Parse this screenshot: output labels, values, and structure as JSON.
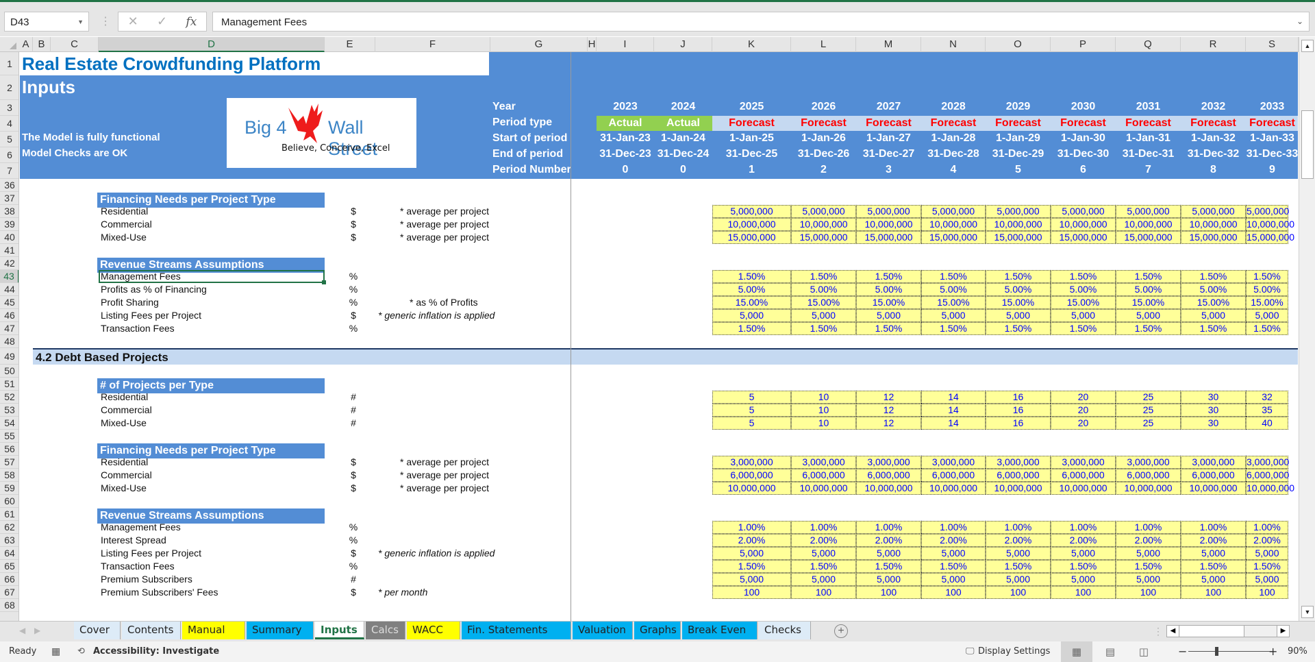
{
  "formula_bar": {
    "name_box": "D43",
    "cancel_icon": "✕",
    "enter_icon": "✓",
    "fx_label": "fx",
    "formula": "Management Fees"
  },
  "columns": [
    "A",
    "B",
    "C",
    "D",
    "E",
    "F",
    "G",
    "H",
    "I",
    "J",
    "K",
    "L",
    "M",
    "N",
    "O",
    "P",
    "Q",
    "R",
    "S"
  ],
  "selected_column": "D",
  "rows": [
    "1",
    "2",
    "3",
    "4",
    "5",
    "6",
    "7",
    "36",
    "37",
    "38",
    "39",
    "40",
    "41",
    "42",
    "43",
    "44",
    "45",
    "46",
    "47",
    "48",
    "49",
    "50",
    "51",
    "52",
    "53",
    "54",
    "55",
    "56",
    "57",
    "58",
    "59",
    "60",
    "61",
    "62",
    "63",
    "64",
    "65",
    "66",
    "67",
    "68"
  ],
  "selected_row": "43",
  "header": {
    "title": "Real Estate Crowdfunding Platform",
    "subtitle": "Inputs",
    "status_line1": "The Model is fully functional",
    "status_line2": "Model Checks are OK",
    "logo": {
      "left_text": "Big 4",
      "right_text": "Wall Street",
      "tagline": "Believe, Conceive, Excel"
    },
    "row_labels": {
      "year": "Year",
      "period_type": "Period type",
      "start": "Start of period",
      "end": "End of period",
      "number": "Period Number"
    },
    "periods": [
      {
        "year": "2023",
        "type": "Actual",
        "start": "31-Jan-23",
        "end": "31-Dec-23",
        "num": "0"
      },
      {
        "year": "2024",
        "type": "Actual",
        "start": "1-Jan-24",
        "end": "31-Dec-24",
        "num": "0"
      },
      {
        "year": "2025",
        "type": "Forecast",
        "start": "1-Jan-25",
        "end": "31-Dec-25",
        "num": "1"
      },
      {
        "year": "2026",
        "type": "Forecast",
        "start": "1-Jan-26",
        "end": "31-Dec-26",
        "num": "2"
      },
      {
        "year": "2027",
        "type": "Forecast",
        "start": "1-Jan-27",
        "end": "31-Dec-27",
        "num": "3"
      },
      {
        "year": "2028",
        "type": "Forecast",
        "start": "1-Jan-28",
        "end": "31-Dec-28",
        "num": "4"
      },
      {
        "year": "2029",
        "type": "Forecast",
        "start": "1-Jan-29",
        "end": "31-Dec-29",
        "num": "5"
      },
      {
        "year": "2030",
        "type": "Forecast",
        "start": "1-Jan-30",
        "end": "31-Dec-30",
        "num": "6"
      },
      {
        "year": "2031",
        "type": "Forecast",
        "start": "1-Jan-31",
        "end": "31-Dec-31",
        "num": "7"
      },
      {
        "year": "2032",
        "type": "Forecast",
        "start": "1-Jan-32",
        "end": "31-Dec-32",
        "num": "8"
      },
      {
        "year": "2033",
        "type": "Forecast",
        "start": "1-Jan-33",
        "end": "31-Dec-33",
        "num": "9"
      }
    ]
  },
  "equity_section": {
    "financing": {
      "title": "Financing Needs per Project Type",
      "rows": [
        {
          "label": "Residential",
          "unit": "$",
          "note": "* average per project",
          "values": [
            "5,000,000",
            "5,000,000",
            "5,000,000",
            "5,000,000",
            "5,000,000",
            "5,000,000",
            "5,000,000",
            "5,000,000",
            "5,000,000"
          ]
        },
        {
          "label": "Commercial",
          "unit": "$",
          "note": "* average per project",
          "values": [
            "10,000,000",
            "10,000,000",
            "10,000,000",
            "10,000,000",
            "10,000,000",
            "10,000,000",
            "10,000,000",
            "10,000,000",
            "10,000,000"
          ]
        },
        {
          "label": "Mixed-Use",
          "unit": "$",
          "note": "* average per project",
          "values": [
            "15,000,000",
            "15,000,000",
            "15,000,000",
            "15,000,000",
            "15,000,000",
            "15,000,000",
            "15,000,000",
            "15,000,000",
            "15,000,000"
          ]
        }
      ]
    },
    "revenue": {
      "title": "Revenue Streams Assumptions",
      "rows": [
        {
          "label": "Management Fees",
          "unit": "%",
          "note": "",
          "values": [
            "1.50%",
            "1.50%",
            "1.50%",
            "1.50%",
            "1.50%",
            "1.50%",
            "1.50%",
            "1.50%",
            "1.50%"
          ]
        },
        {
          "label": "Profits as % of Financing",
          "unit": "%",
          "note": "",
          "values": [
            "5.00%",
            "5.00%",
            "5.00%",
            "5.00%",
            "5.00%",
            "5.00%",
            "5.00%",
            "5.00%",
            "5.00%"
          ]
        },
        {
          "label": "Profit Sharing",
          "unit": "%",
          "note": "* as % of Profits",
          "values": [
            "15.00%",
            "15.00%",
            "15.00%",
            "15.00%",
            "15.00%",
            "15.00%",
            "15.00%",
            "15.00%",
            "15.00%"
          ]
        },
        {
          "label": "Listing Fees per Project",
          "unit": "$",
          "note": "* generic inflation is applied",
          "values": [
            "5,000",
            "5,000",
            "5,000",
            "5,000",
            "5,000",
            "5,000",
            "5,000",
            "5,000",
            "5,000"
          ]
        },
        {
          "label": "Transaction Fees",
          "unit": "%",
          "note": "",
          "values": [
            "1.50%",
            "1.50%",
            "1.50%",
            "1.50%",
            "1.50%",
            "1.50%",
            "1.50%",
            "1.50%",
            "1.50%"
          ]
        }
      ]
    }
  },
  "debt_section": {
    "title": "4.2 Debt Based Projects",
    "projects": {
      "title": "# of Projects per Type",
      "rows": [
        {
          "label": "Residential",
          "unit": "#",
          "note": "",
          "values": [
            "5",
            "10",
            "12",
            "14",
            "16",
            "20",
            "25",
            "30",
            "32"
          ]
        },
        {
          "label": "Commercial",
          "unit": "#",
          "note": "",
          "values": [
            "5",
            "10",
            "12",
            "14",
            "16",
            "20",
            "25",
            "30",
            "35"
          ]
        },
        {
          "label": "Mixed-Use",
          "unit": "#",
          "note": "",
          "values": [
            "5",
            "10",
            "12",
            "14",
            "16",
            "20",
            "25",
            "30",
            "40"
          ]
        }
      ]
    },
    "financing": {
      "title": "Financing Needs per Project Type",
      "rows": [
        {
          "label": "Residential",
          "unit": "$",
          "note": "* average per project",
          "values": [
            "3,000,000",
            "3,000,000",
            "3,000,000",
            "3,000,000",
            "3,000,000",
            "3,000,000",
            "3,000,000",
            "3,000,000",
            "3,000,000"
          ]
        },
        {
          "label": "Commercial",
          "unit": "$",
          "note": "* average per project",
          "values": [
            "6,000,000",
            "6,000,000",
            "6,000,000",
            "6,000,000",
            "6,000,000",
            "6,000,000",
            "6,000,000",
            "6,000,000",
            "6,000,000"
          ]
        },
        {
          "label": "Mixed-Use",
          "unit": "$",
          "note": "* average per project",
          "values": [
            "10,000,000",
            "10,000,000",
            "10,000,000",
            "10,000,000",
            "10,000,000",
            "10,000,000",
            "10,000,000",
            "10,000,000",
            "10,000,000"
          ]
        }
      ]
    },
    "revenue": {
      "title": "Revenue Streams Assumptions",
      "rows": [
        {
          "label": "Management Fees",
          "unit": "%",
          "note": "",
          "values": [
            "1.00%",
            "1.00%",
            "1.00%",
            "1.00%",
            "1.00%",
            "1.00%",
            "1.00%",
            "1.00%",
            "1.00%"
          ]
        },
        {
          "label": "Interest Spread",
          "unit": "%",
          "note": "",
          "values": [
            "2.00%",
            "2.00%",
            "2.00%",
            "2.00%",
            "2.00%",
            "2.00%",
            "2.00%",
            "2.00%",
            "2.00%"
          ]
        },
        {
          "label": "Listing Fees per Project",
          "unit": "$",
          "note": "* generic inflation is applied",
          "values": [
            "5,000",
            "5,000",
            "5,000",
            "5,000",
            "5,000",
            "5,000",
            "5,000",
            "5,000",
            "5,000"
          ]
        },
        {
          "label": "Transaction Fees",
          "unit": "%",
          "note": "",
          "values": [
            "1.50%",
            "1.50%",
            "1.50%",
            "1.50%",
            "1.50%",
            "1.50%",
            "1.50%",
            "1.50%",
            "1.50%"
          ]
        },
        {
          "label": "Premium Subscribers",
          "unit": "#",
          "note": "",
          "values": [
            "5,000",
            "5,000",
            "5,000",
            "5,000",
            "5,000",
            "5,000",
            "5,000",
            "5,000",
            "5,000"
          ]
        },
        {
          "label": "Premium Subscribers' Fees",
          "unit": "$",
          "note": "* per month",
          "values": [
            "100",
            "100",
            "100",
            "100",
            "100",
            "100",
            "100",
            "100",
            "100"
          ]
        }
      ]
    }
  },
  "sheet_tabs": [
    {
      "label": "Cover",
      "color": "#ddebf7"
    },
    {
      "label": "Contents",
      "color": "#ddebf7"
    },
    {
      "label": "Manual",
      "color": "#ffff00"
    },
    {
      "label": "Summary",
      "color": "#00b0f0"
    },
    {
      "label": "Inputs",
      "color": "#ffffff",
      "active": true
    },
    {
      "label": "Calcs",
      "color": "#808080"
    },
    {
      "label": "WACC",
      "color": "#ffff00"
    },
    {
      "label": "Fin. Statements",
      "color": "#00b0f0"
    },
    {
      "label": "Valuation",
      "color": "#00b0f0"
    },
    {
      "label": "Graphs",
      "color": "#00b0f0"
    },
    {
      "label": "Break Even",
      "color": "#00b0f0"
    },
    {
      "label": "Checks",
      "color": "#ddebf7"
    }
  ],
  "status_bar": {
    "ready": "Ready",
    "accessibility": "Accessibility: Investigate",
    "display_settings": "Display Settings",
    "zoom_minus": "−",
    "zoom_plus": "+",
    "zoom_level": "90%"
  },
  "colors": {
    "excel_green": "#217346",
    "header_blue": "#538dd5",
    "title_blue": "#0070c0",
    "actual_green": "#92d050",
    "forecast_band": "#c5d9f1",
    "forecast_red": "#ff0000",
    "input_yellow": "#ffff99",
    "input_text": "#0000ff"
  }
}
